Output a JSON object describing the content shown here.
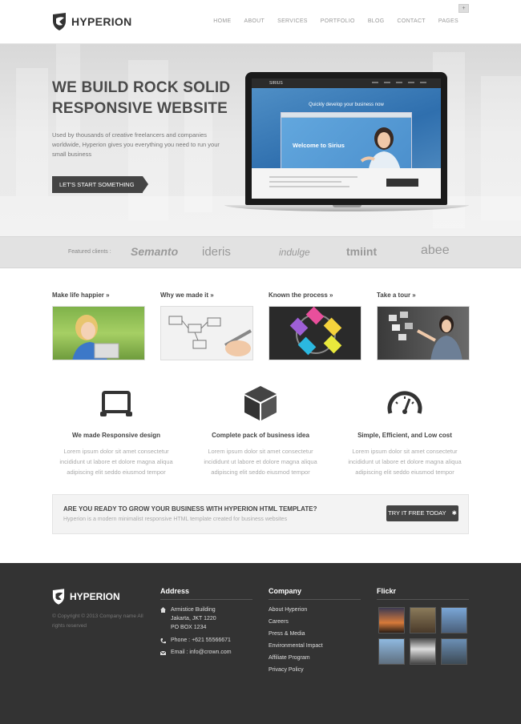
{
  "header": {
    "brand": "HYPERION",
    "nav": [
      "HOME",
      "ABOUT",
      "SERVICES",
      "PORTFOLIO",
      "BLOG",
      "CONTACT",
      "PAGES"
    ],
    "search_glyph": "+"
  },
  "hero": {
    "title_line1": "WE BUILD ROCK SOLID",
    "title_line2": "RESPONSIVE WEBSITE",
    "text": "Used by thousands of creative freelancers and companies worldwide, Hyperion gives you everything you need to run your small business",
    "cta": "LET'S START SOMETHING",
    "screen": {
      "brand": "SIRIUS",
      "headline": "Quickly develop your business now",
      "welcome": "Welcome to Sirius"
    }
  },
  "clients": {
    "label": "Featured clients :",
    "names": [
      "Semanto",
      "ideris",
      "indulge",
      "tmiint",
      "abee"
    ]
  },
  "features": [
    {
      "title": "Make life happier »",
      "icon": "woman-laptop-photo"
    },
    {
      "title": "Why we made it »",
      "icon": "sketch-flowchart-photo"
    },
    {
      "title": "Known the process »",
      "icon": "process-cycle-photo"
    },
    {
      "title": "Take a tour »",
      "icon": "touchscreen-photo"
    }
  ],
  "services": [
    {
      "title": "We made Responsive design",
      "text": "Lorem ipsum dolor sit amet consectetur incididunt ut labore et dolore magna aliqua adipiscing elit seddo eiusmod tempor",
      "icon": "tablet-icon"
    },
    {
      "title": "Complete pack of business idea",
      "text": "Lorem ipsum dolor sit amet consectetur incididunt ut labore et dolore magna aliqua adipiscing elit seddo eiusmod tempor",
      "icon": "cube-icon"
    },
    {
      "title": "Simple, Efficient, and Low cost",
      "text": "Lorem ipsum dolor sit amet consectetur incididunt ut labore et dolore magna aliqua adipiscing elit seddo eiusmod tempor",
      "icon": "speedometer-icon"
    }
  ],
  "cta": {
    "title": "ARE YOU READY TO GROW YOUR BUSINESS WITH HYPERION HTML TEMPLATE?",
    "subtitle": "Hyperion is a modern minimalist responsive HTML template created for business websites",
    "button": "TRY IT FREE TODAY"
  },
  "footer": {
    "brand": "HYPERION",
    "copyright": "© Copyright © 2013 Company name All rights reserved",
    "address": {
      "title": "Address",
      "lines": [
        "Armistice Building",
        "Jakarta, JKT 1220",
        "PO BOX 1234"
      ],
      "phone": "Phone : +621 55566671",
      "email": "Email : info@crown.com"
    },
    "company": {
      "title": "Company",
      "links": [
        "About Hyperion",
        "Careers",
        "Press & Media",
        "Environmental Impact",
        "Affiliate Program",
        "Privacy Policy"
      ]
    },
    "flickr": {
      "title": "Flickr"
    }
  },
  "colors": {
    "dark": "#333333",
    "button": "#444444",
    "text_muted": "#aaaaaa"
  }
}
